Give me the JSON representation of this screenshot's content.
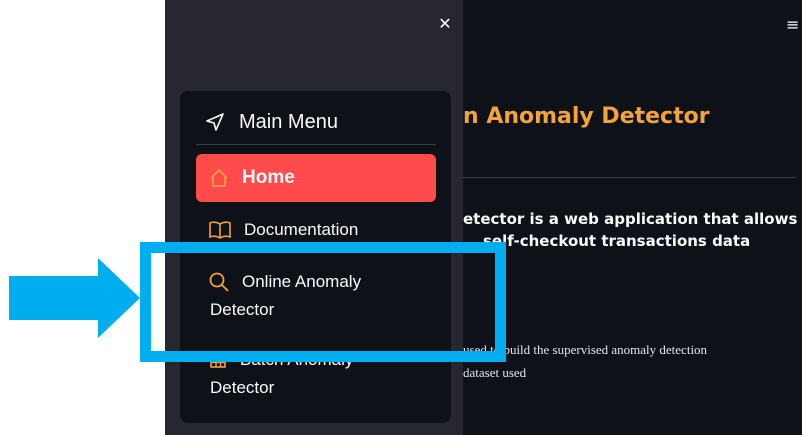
{
  "app": {
    "page_title": "n Anomaly Detector",
    "description_lines": [
      "etector is a web application that allows",
      "self-checkout transactions data"
    ],
    "small_lines": [
      "used to build the supervised anomaly detection",
      "dataset used"
    ],
    "hamburger_icon": "≡"
  },
  "sidebar": {
    "close_icon": "✕",
    "menu_title": "Main Menu",
    "menu_icon": "➤",
    "items": [
      {
        "label": "Home",
        "icon": "home-icon",
        "glyph": "⌂",
        "active": true
      },
      {
        "label": "Documentation",
        "icon": "book-icon",
        "glyph": "📖",
        "active": false
      },
      {
        "label_line1": "Online Anomaly",
        "label_line2": "Detector",
        "icon": "search-icon",
        "glyph": "⚲",
        "active": false
      },
      {
        "label_line1": "Batch Anomaly",
        "label_line2": "Detector",
        "icon": "table-icon",
        "glyph": "▦",
        "active": false
      }
    ]
  },
  "colors": {
    "accent": "#ff4b4b",
    "orange": "#f6a23a",
    "annotation": "#00aeef",
    "sidebar_bg": "#262730",
    "main_bg": "#0e1117"
  }
}
